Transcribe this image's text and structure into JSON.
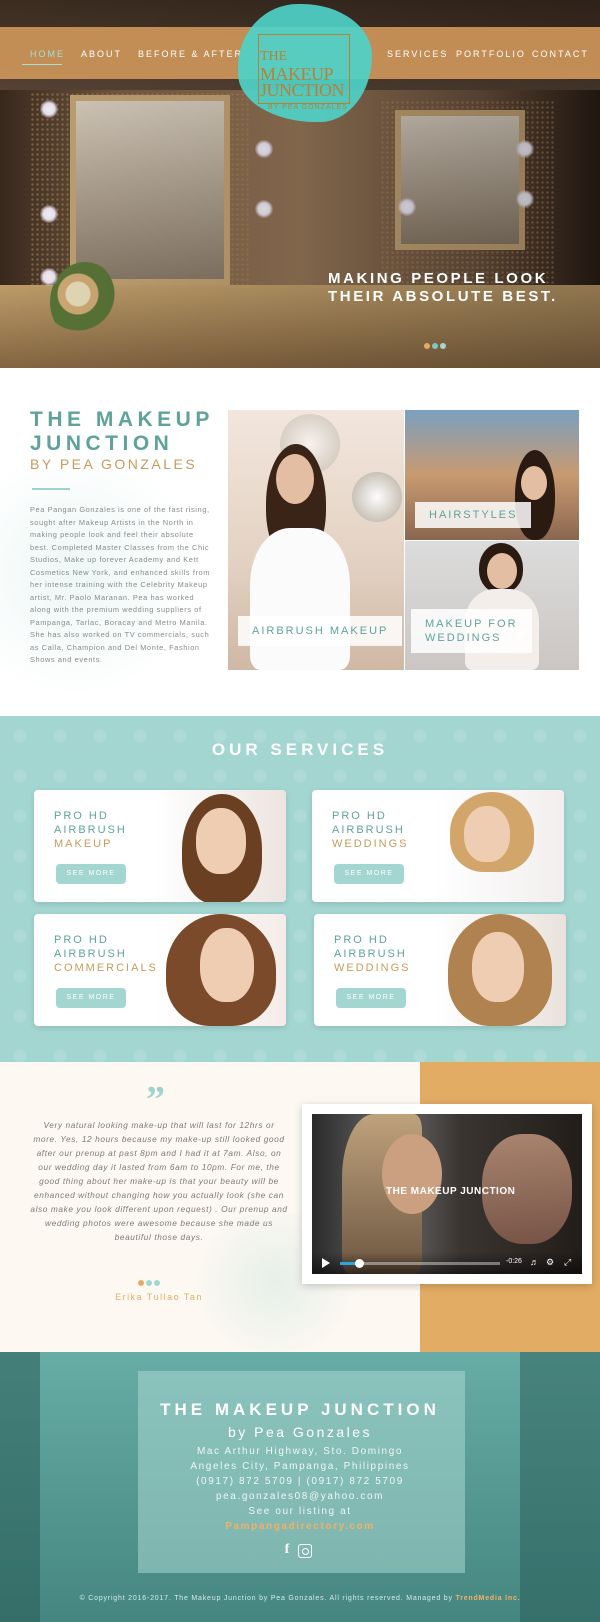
{
  "nav": {
    "items_left": [
      "HOME",
      "ABOUT",
      "BEFORE & AFTER"
    ],
    "items_right": [
      "SERVICES",
      "PORTFOLIO",
      "CONTACT"
    ],
    "active": "HOME"
  },
  "logo": {
    "line1": "THE",
    "line2": "MAKEUP",
    "line3": "JUNCTION",
    "line4": "BY PEA GONZALES"
  },
  "hero": {
    "headline_1": "MAKING PEOPLE LOOK",
    "headline_2": "THEIR ABSOLUTE BEST.",
    "slides": 3,
    "active_slide": 1
  },
  "about": {
    "title_1": "THE MAKEUP",
    "title_2": "JUNCTION",
    "subtitle": "BY PEA GONZALES",
    "body": "Pea Pangan Gonzales is one of the fast rising, sought after Makeup Artists in the North in making people look and feel their absolute best. Completed Master Classes from the Chic Studios, Make up forever Academy and Kett Cosmetics New York, and enhanced skills from her intense training with the Celebrity Makeup artist, Mr. Paolo Maranan. Pea has worked along with the premium wedding suppliers of Pampanga, Tarlac, Boracay and Metro Manila. She has also worked on TV commercials, such as Calla, Champion and Del Monte, Fashion Shows and events.",
    "tiles": {
      "airbrush": "AIRBRUSH MAKEUP",
      "hairstyles": "HAIRSTYLES",
      "weddings_1": "MAKEUP FOR",
      "weddings_2": "WEDDINGS"
    }
  },
  "services": {
    "title": "OUR SERVICES",
    "button_label": "SEE MORE",
    "cards": [
      {
        "line1": "PRO HD",
        "line2": "AIRBRUSH",
        "line3": "MAKEUP"
      },
      {
        "line1": "PRO HD",
        "line2": "AIRBRUSH",
        "line3": "WEDDINGS"
      },
      {
        "line1": "PRO HD",
        "line2": "AIRBRUSH",
        "line3": "COMMERCIALS"
      },
      {
        "line1": "PRO HD",
        "line2": "AIRBRUSH",
        "line3": "WEDDINGS"
      }
    ]
  },
  "testimonial": {
    "quote_mark": "”",
    "text": "Very natural looking make-up that will last for 12hrs or more. Yes, 12 hours because my make-up still looked good after our prenup at past 8pm and I had it at 7am. Also, on our wedding day it lasted from 6am to 10pm. For me, the good thing about her make-up is that your beauty will be enhanced without changing how you actually look (she can also make you look different upon request) . Our prenup and wedding photos were awesome because she made us beautiful those days.",
    "author": "Erika Tullao Tan",
    "slides": 3,
    "active_slide": 1
  },
  "video": {
    "title": "THE MAKEUP JUNCTION",
    "time": "-0:26",
    "progress": 0.12
  },
  "footer": {
    "title": "THE MAKEUP JUNCTION",
    "subtitle": "by Pea Gonzales",
    "address_1": "Mac Arthur Highway, Sto. Domingo",
    "address_2": "Angeles City, Pampanga, Philippines",
    "phones": "(0917) 872 5709 | (0917) 872 5709",
    "email": "pea.gonzales08@yahoo.com",
    "listing_label": "See our listing at",
    "listing_link": "Pampangadirectory.com",
    "copyright": "© Copyright 2016-2017. The Makeup Junction by Pea Gonzales. All rights reserved. Managed by",
    "managed_by": "TrendMedia Inc."
  },
  "colors": {
    "teal": "#5fa29b",
    "mint": "#a3d6d1",
    "gold": "#c99a5b",
    "orange": "#e3ac64",
    "nav_bg": "#cd965a"
  },
  "icons": [
    "facebook-icon",
    "instagram-icon",
    "play-icon",
    "volume-icon",
    "settings-icon",
    "fullscreen-icon",
    "quote-icon"
  ]
}
